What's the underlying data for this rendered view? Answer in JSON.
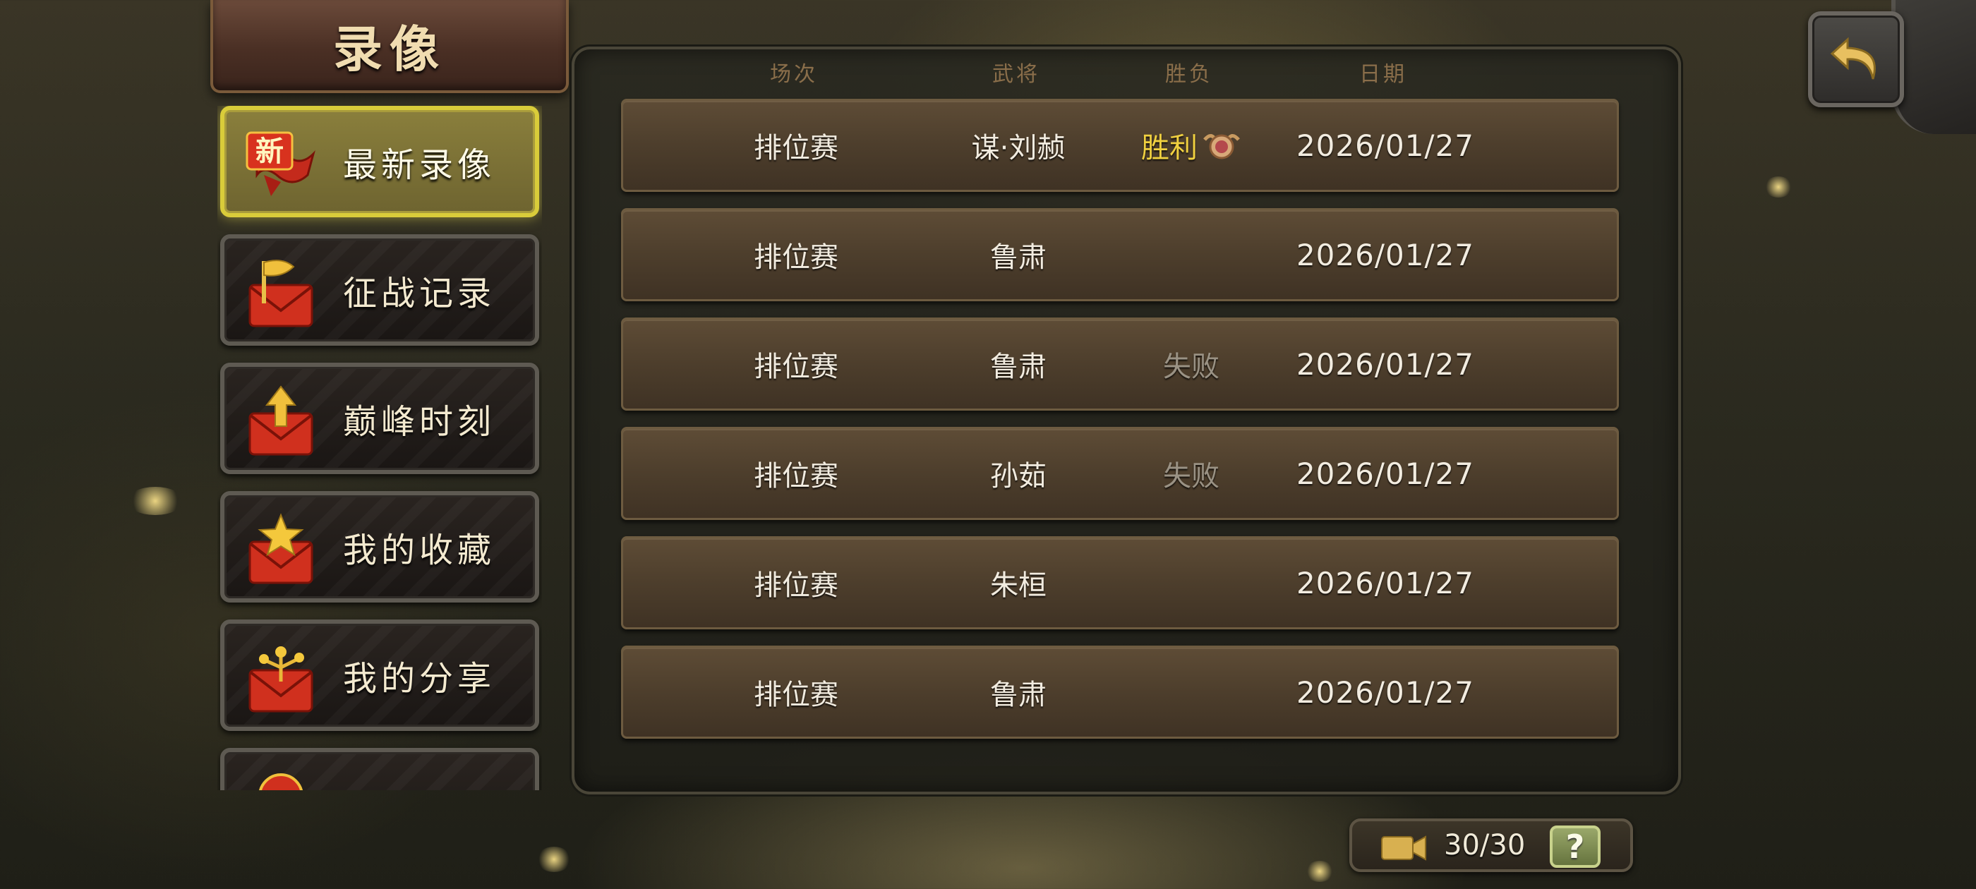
{
  "title": "录像",
  "sidebar": {
    "items": [
      {
        "label": "最新录像",
        "icon": "new-badge-icon",
        "badge": "新",
        "active": true
      },
      {
        "label": "征战记录",
        "icon": "flag-envelope-icon",
        "active": false
      },
      {
        "label": "巅峰时刻",
        "icon": "arrow-up-envelope-icon",
        "active": false
      },
      {
        "label": "我的收藏",
        "icon": "star-envelope-icon",
        "active": false
      },
      {
        "label": "我的分享",
        "icon": "share-envelope-icon",
        "active": false
      },
      {
        "label": "",
        "icon": "partial-envelope-icon",
        "active": false
      }
    ]
  },
  "table": {
    "headers": [
      "场次",
      "武将",
      "胜负",
      "日期"
    ],
    "rows": [
      {
        "type": "排位赛",
        "general": "谋·刘赪",
        "result": "胜利",
        "result_kind": "win",
        "date": "2026/01/27"
      },
      {
        "type": "排位赛",
        "general": "鲁肃",
        "result": "",
        "result_kind": "none",
        "date": "2026/01/27"
      },
      {
        "type": "排位赛",
        "general": "鲁肃",
        "result": "失败",
        "result_kind": "lose",
        "date": "2026/01/27"
      },
      {
        "type": "排位赛",
        "general": "孙茹",
        "result": "失败",
        "result_kind": "lose",
        "date": "2026/01/27"
      },
      {
        "type": "排位赛",
        "general": "朱桓",
        "result": "",
        "result_kind": "none",
        "date": "2026/01/27"
      },
      {
        "type": "排位赛",
        "general": "鲁肃",
        "result": "",
        "result_kind": "none",
        "date": "2026/01/27"
      }
    ]
  },
  "footer": {
    "counter": "30/30",
    "help_label": "?",
    "camera_icon": "video-camera-icon"
  },
  "colors": {
    "win": "#f0d040",
    "lose": "#9a9284",
    "active_border": "#d9cc3a"
  }
}
